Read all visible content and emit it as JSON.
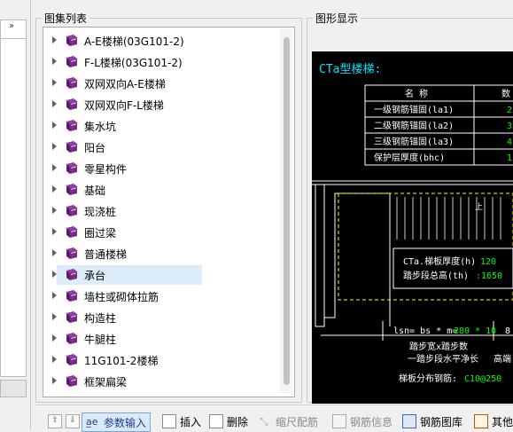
{
  "atlas_panel": {
    "title": "图集列表"
  },
  "display_panel": {
    "title": "图形显示"
  },
  "tree_items": [
    {
      "label": "A-E楼梯(03G101-2)"
    },
    {
      "label": "F-L楼梯(03G101-2)"
    },
    {
      "label": "双网双向A-E楼梯"
    },
    {
      "label": "双网双向F-L楼梯"
    },
    {
      "label": "集水坑"
    },
    {
      "label": "阳台"
    },
    {
      "label": "零星构件"
    },
    {
      "label": "基础"
    },
    {
      "label": "现浇桩"
    },
    {
      "label": "圈过梁"
    },
    {
      "label": "普通楼梯"
    },
    {
      "label": "承台",
      "selected": true
    },
    {
      "label": "墙柱或砌体拉筋"
    },
    {
      "label": "构造柱"
    },
    {
      "label": "牛腿柱"
    },
    {
      "label": "11G101-2楼梯"
    },
    {
      "label": "框架扁梁"
    }
  ],
  "drawing": {
    "title": "CTa型楼梯:",
    "table_header": [
      "名  称",
      "数"
    ],
    "table_rows": [
      {
        "name": "一级钢筋锚固(la1)",
        "value": "2"
      },
      {
        "name": "二级钢筋锚固(la2)",
        "value": "3"
      },
      {
        "name": "三级钢筋锚固(la3)",
        "value": "4"
      },
      {
        "name": "保护层厚度(bhc)",
        "value": "1"
      }
    ],
    "thickness_label": "CTa.梯板厚度(h)",
    "thickness_value": "120",
    "height_label": "踏步段总高(th)",
    "height_value": ":1650",
    "formula_prefix": "lsn= bs * m=",
    "formula_value": "280 * 10",
    "formula_tail": "8",
    "step_width_label": "踏步宽x踏步数",
    "span_label": "一踏步段水平净长",
    "high_end": "高端",
    "dist_label": "梯板分布钢筋:",
    "dist_value": "C10@250",
    "colors": {
      "cyan": "#00e5ff",
      "green": "#00ff00",
      "white": "#ffffff",
      "yellow": "#ffff00"
    }
  },
  "toolbar": {
    "param_input": "参数输入",
    "insert": "插入",
    "delete": "删除",
    "shrink": "缩尺配筋",
    "rebar_info": "钢筋信息",
    "rebar_library": "钢筋图库",
    "other": "其他"
  },
  "left_strip": {
    "arrows": "»"
  }
}
